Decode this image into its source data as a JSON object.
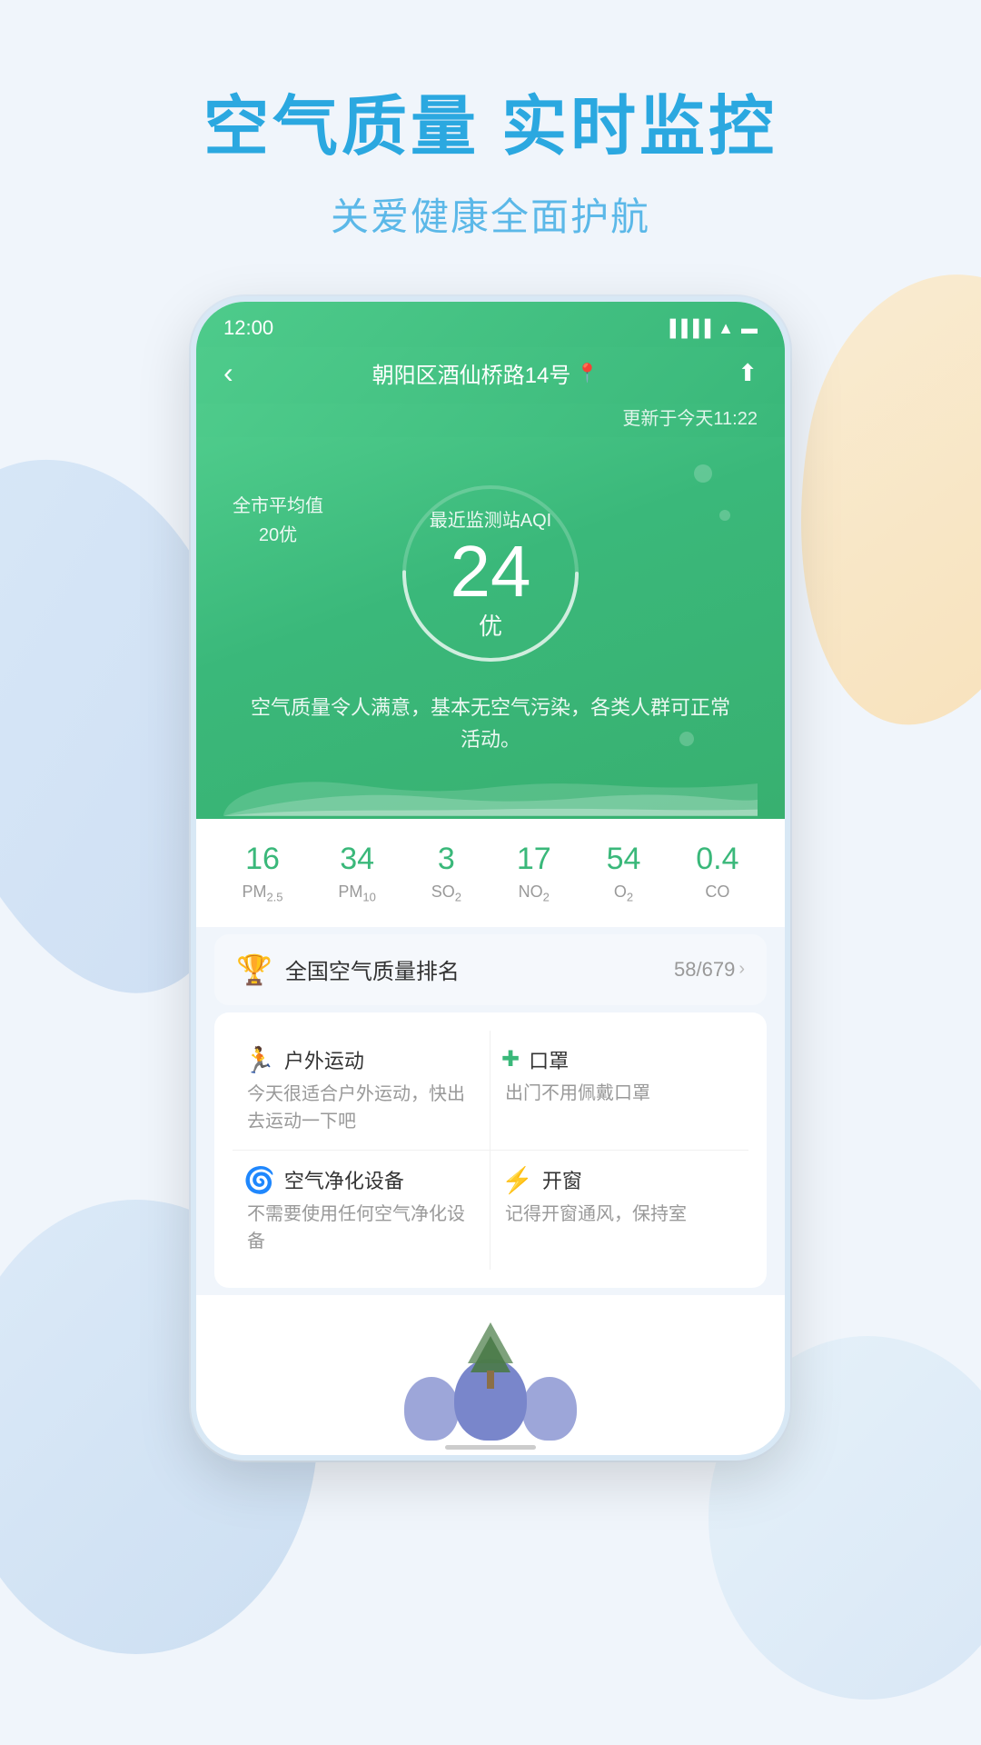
{
  "page": {
    "main_title": "空气质量 实时监控",
    "sub_title": "关爱健康全面护航"
  },
  "status_bar": {
    "time": "12:00",
    "navigation_arrow": "›"
  },
  "app_header": {
    "back_label": "‹",
    "location": "朝阳区酒仙桥路14号",
    "location_pin": "📍",
    "share_icon": "⬆",
    "update_text": "更新于今天11:22"
  },
  "aqi": {
    "city_avg_label": "全市平均值",
    "city_avg_value": "20优",
    "station_label": "最近监测站AQI",
    "value": "24",
    "quality": "优",
    "description": "空气质量令人满意，基本无空气污染，各类人群可正常活动。"
  },
  "metrics": [
    {
      "value": "16",
      "label": "PM₂.₅",
      "label_html": "PM<sub>2.5</sub>"
    },
    {
      "value": "34",
      "label": "PM₁₀",
      "label_html": "PM<sub>10</sub>"
    },
    {
      "value": "3",
      "label": "SO₂",
      "label_html": "SO<sub>2</sub>"
    },
    {
      "value": "17",
      "label": "NO₂",
      "label_html": "NO<sub>2</sub>"
    },
    {
      "value": "54",
      "label": "O₂",
      "label_html": "O<sub>2</sub>"
    },
    {
      "value": "0.4",
      "label": "CO",
      "label_html": "CO"
    }
  ],
  "ranking": {
    "icon": "🏆",
    "label": "全国空气质量排名",
    "value": "58/679",
    "chevron": "›"
  },
  "lifestyle": [
    {
      "icon": "🏃",
      "title": "户外运动",
      "desc": "今天很适合户外运动，快出去运动一下吧"
    },
    {
      "icon": "➕",
      "title": "口罩",
      "desc": "出门不用佩戴口罩"
    },
    {
      "icon": "🌀",
      "title": "空气净化设备",
      "desc": "不需要使用任何空气净化设备"
    },
    {
      "icon": "⚡",
      "title": "开窗",
      "desc": "记得开窗通风，保持室内空气清新"
    }
  ]
}
